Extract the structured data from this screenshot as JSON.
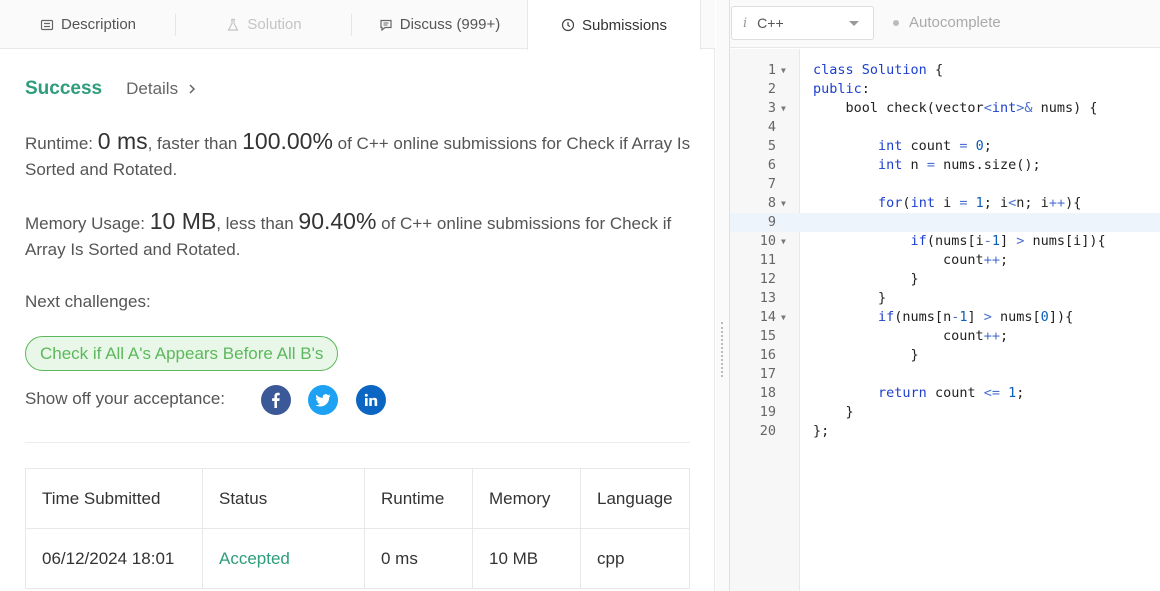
{
  "tabs": [
    {
      "label": "Description",
      "icon": "description-icon"
    },
    {
      "label": "Solution",
      "icon": "flask-icon"
    },
    {
      "label": "Discuss (999+)",
      "icon": "comment-icon"
    },
    {
      "label": "Submissions",
      "icon": "clock-icon"
    }
  ],
  "result": {
    "status": "Success",
    "details": "Details"
  },
  "runtime": {
    "label": "Runtime:",
    "value": "0 ms",
    "mid": ", faster than ",
    "percent": "100.00%",
    "tail": " of C++ online submissions for Check if Array Is Sorted and Rotated."
  },
  "memory": {
    "label": "Memory Usage:",
    "value": "10 MB",
    "mid": ", less than ",
    "percent": "90.40%",
    "tail": " of C++ online submissions for Check if Array Is Sorted and Rotated."
  },
  "next_challenges": {
    "label": "Next challenges:",
    "items": [
      "Check if All A's Appears Before All B's"
    ]
  },
  "share": {
    "label": "Show off your acceptance:",
    "networks": [
      {
        "name": "facebook",
        "color": "#3b5998"
      },
      {
        "name": "twitter",
        "color": "#1da1f2"
      },
      {
        "name": "linkedin",
        "color": "#0a66c2"
      }
    ]
  },
  "submissions_table": {
    "headers": [
      "Time Submitted",
      "Status",
      "Runtime",
      "Memory",
      "Language"
    ],
    "rows": [
      [
        "06/12/2024 18:01",
        "Accepted",
        "0 ms",
        "10 MB",
        "cpp"
      ]
    ]
  },
  "editor": {
    "language": "C++",
    "autocomplete_label": "Autocomplete",
    "line_numbers": [
      "1",
      "2",
      "3",
      "4",
      "5",
      "6",
      "7",
      "8",
      "9",
      "10",
      "11",
      "12",
      "13",
      "14",
      "15",
      "16",
      "17",
      "18",
      "19",
      "20"
    ],
    "highlighted_line": 9
  },
  "colors": {
    "success": "#2e9d7c",
    "chip": "#5cb85c",
    "keyword": "#1c3fcf"
  }
}
